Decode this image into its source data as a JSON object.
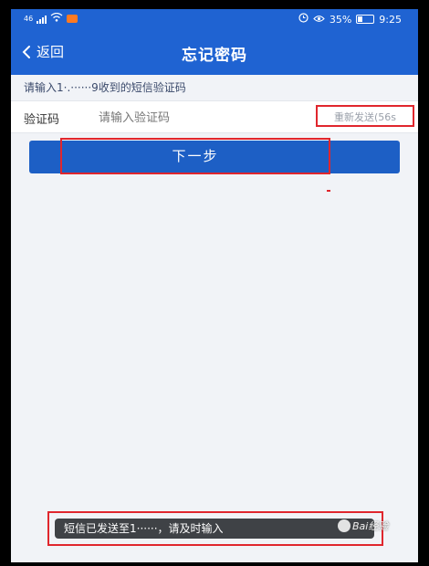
{
  "status_bar": {
    "network_label": "46",
    "battery_percent": "35%",
    "time": "9:25"
  },
  "header": {
    "back_label": "返回",
    "title": "忘记密码"
  },
  "hint": {
    "text": "请输入1·.······9收到的短信验证码"
  },
  "code_row": {
    "label": "验证码",
    "placeholder": "请输入验证码",
    "resend_label": "重新发送(56s"
  },
  "next_button": {
    "label": "下一步"
  },
  "toast": {
    "text": "短信已发送至1······，请及时输入"
  },
  "watermark": {
    "text": "Bai经验"
  },
  "colors": {
    "header_blue": "#1f63d2",
    "button_blue": "#1d5fc5",
    "highlight_red": "#e0262d",
    "background": "#f1f3f7"
  }
}
